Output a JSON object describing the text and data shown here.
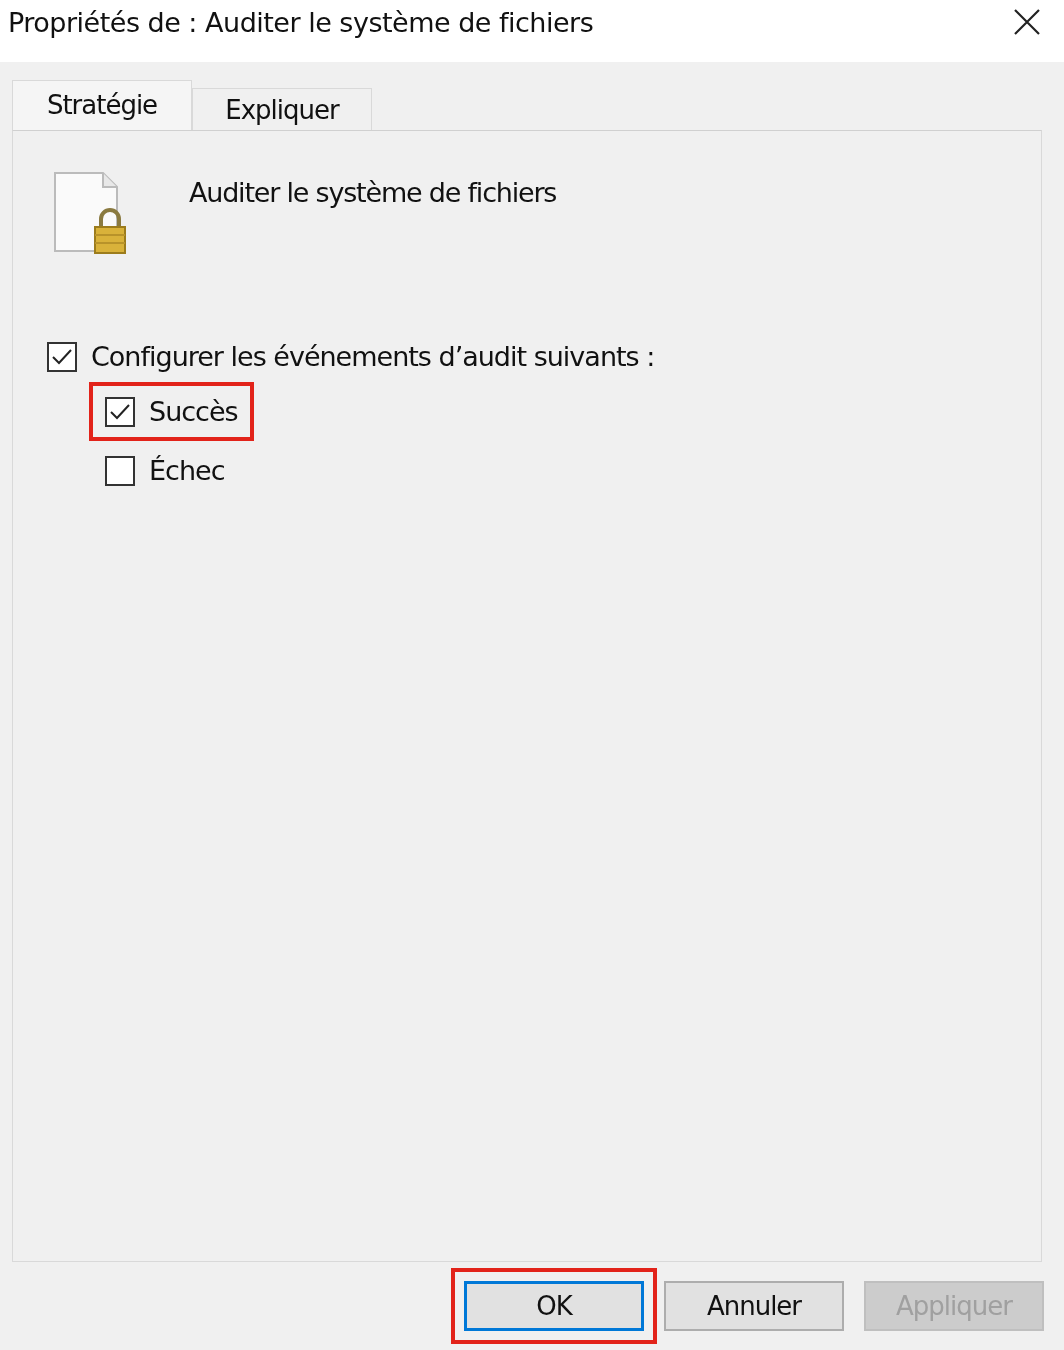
{
  "window": {
    "title": "Propriétés de : Auditer le système de fichiers"
  },
  "tabs": [
    {
      "label": "Stratégie",
      "selected": true
    },
    {
      "label": "Expliquer",
      "selected": false
    }
  ],
  "policy": {
    "name": "Auditer le système de fichiers"
  },
  "configure": {
    "label": "Configurer les événements d’audit suivants :",
    "checked": true
  },
  "options": [
    {
      "label": "Succès",
      "checked": true,
      "highlighted": true
    },
    {
      "label": "Échec",
      "checked": false,
      "highlighted": false
    }
  ],
  "buttons": [
    {
      "label": "OK",
      "default": true,
      "disabled": false,
      "highlighted": true
    },
    {
      "label": "Annuler",
      "default": false,
      "disabled": false,
      "highlighted": false
    },
    {
      "label": "Appliquer",
      "default": false,
      "disabled": true,
      "highlighted": false
    }
  ]
}
